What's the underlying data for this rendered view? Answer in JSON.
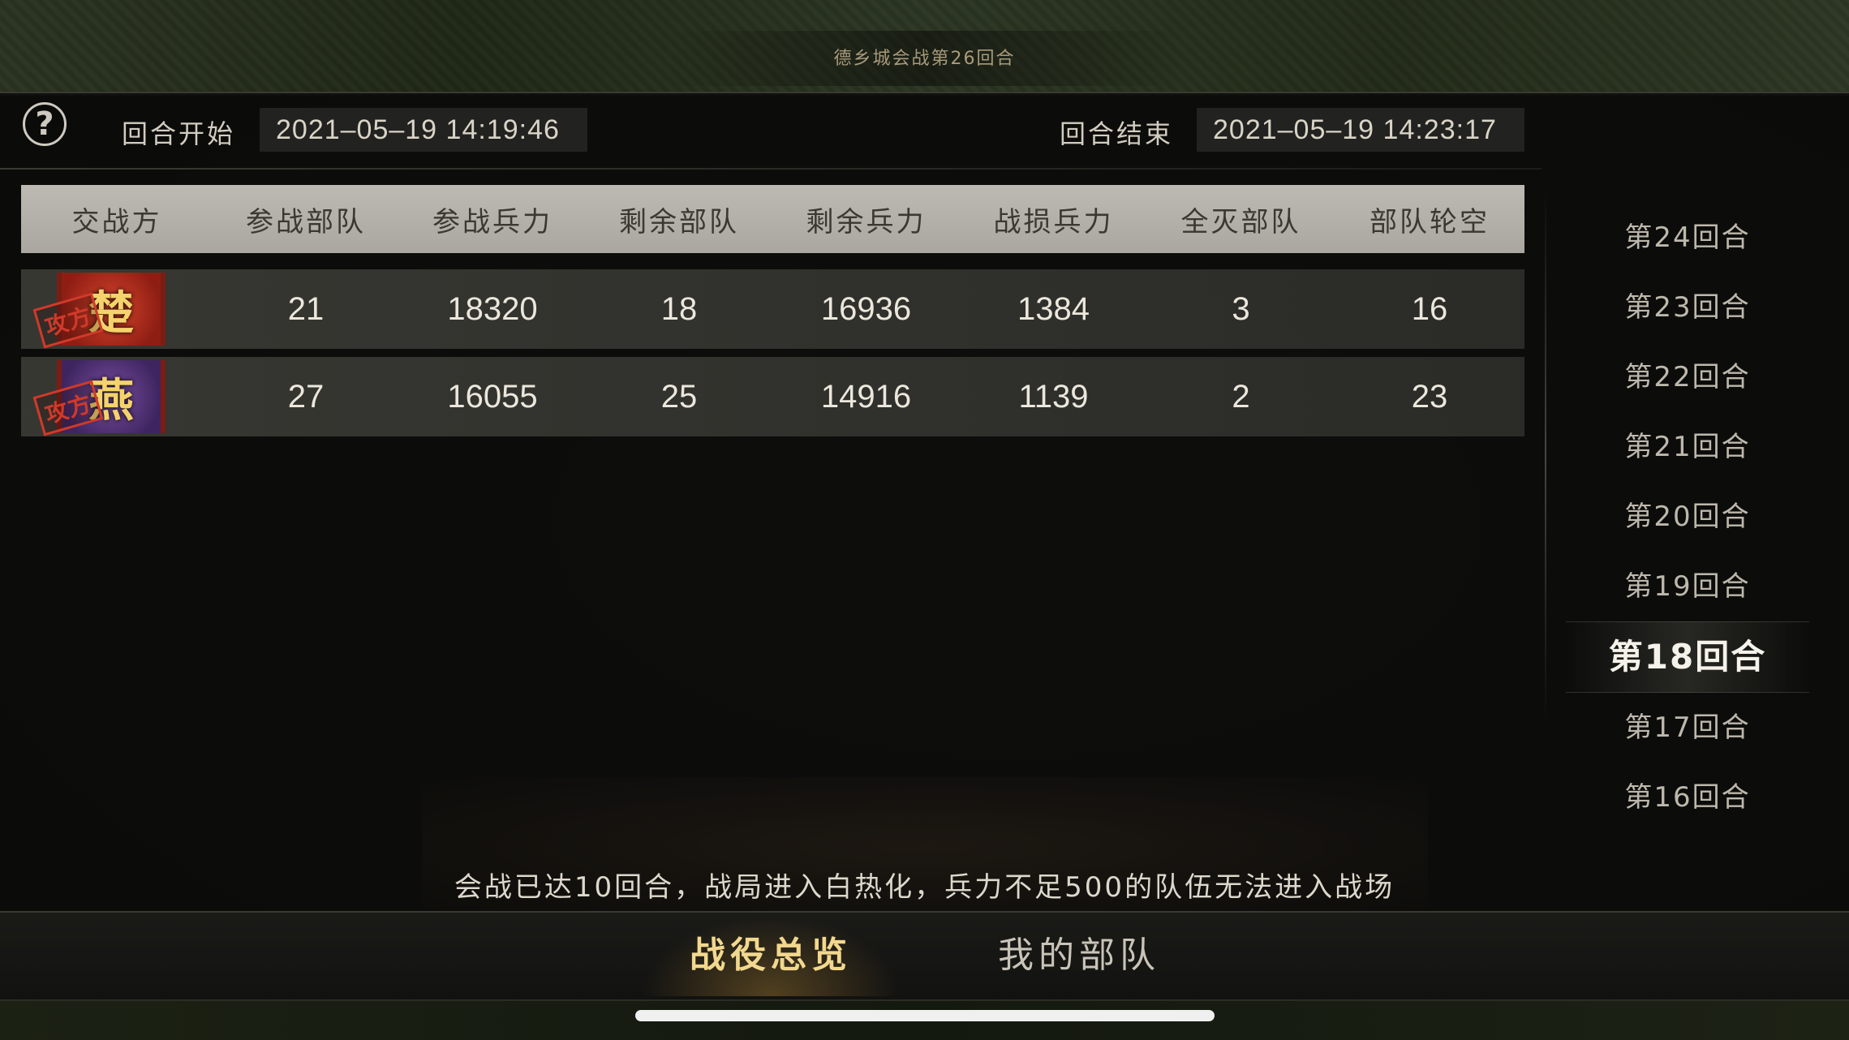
{
  "header": {
    "battle_title": "德乡城会战第26回合"
  },
  "round_time": {
    "start_label": "回合开始",
    "start_value": "2021–05–19  14:19:46",
    "end_label": "回合结束",
    "end_value": "2021–05–19  14:23:17"
  },
  "table": {
    "columns": [
      "交战方",
      "参战部队",
      "参战兵力",
      "剩余部队",
      "剩余兵力",
      "战损兵力",
      "全灭部队",
      "部队轮空"
    ],
    "rows": [
      {
        "faction": "楚",
        "stamp": "攻方",
        "cells": [
          "21",
          "18320",
          "18",
          "16936",
          "1384",
          "3",
          "16"
        ]
      },
      {
        "faction": "燕",
        "stamp": "攻方",
        "cells": [
          "27",
          "16055",
          "25",
          "14916",
          "1139",
          "2",
          "23"
        ]
      }
    ]
  },
  "rounds": {
    "items": [
      "第24回合",
      "第23回合",
      "第22回合",
      "第21回合",
      "第20回合",
      "第19回合",
      "第18回合",
      "第17回合",
      "第16回合"
    ],
    "selected": "第18回合"
  },
  "notice": "会战已达10回合，战局进入白热化，兵力不足500的队伍无法进入战场",
  "tabs": {
    "overview": "战役总览",
    "my_troops": "我的部队",
    "active": "overview"
  },
  "colors": {
    "accent_gold": "#f2d88e",
    "chu_red": "#d9452c",
    "yan_purple": "#7a4fa0",
    "stamp_red": "#d03a2a"
  }
}
